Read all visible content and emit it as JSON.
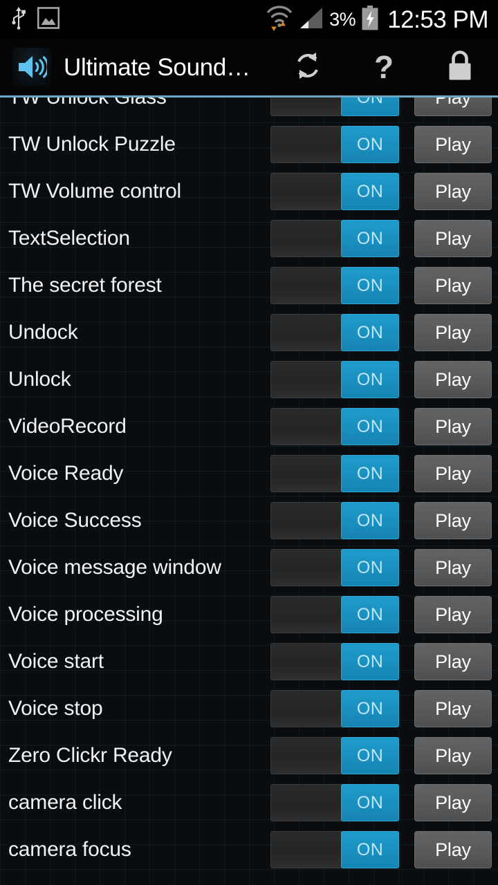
{
  "status_bar": {
    "left_icons": [
      "usb-icon",
      "screenshot-image-icon"
    ],
    "right_icons": [
      "wifi-transfer-icon",
      "cellular-signal-icon",
      "battery-charging-icon"
    ],
    "battery_percent": "3%",
    "clock": "12:53 PM"
  },
  "action_bar": {
    "app_icon": "speaker-volume-icon",
    "title": "Ultimate Sound…",
    "actions": [
      {
        "name": "refresh-button",
        "icon": "refresh-icon"
      },
      {
        "name": "help-button",
        "icon": "question-mark-icon",
        "label": "?"
      },
      {
        "name": "lock-button",
        "icon": "lock-icon"
      }
    ]
  },
  "list": {
    "toggle_on_label": "ON",
    "play_label": "Play",
    "rows": [
      {
        "label": "TW Unlock Glass",
        "toggle": "ON",
        "play": "Play"
      },
      {
        "label": "TW Unlock Puzzle",
        "toggle": "ON",
        "play": "Play"
      },
      {
        "label": "TW Volume control",
        "toggle": "ON",
        "play": "Play"
      },
      {
        "label": "TextSelection",
        "toggle": "ON",
        "play": "Play"
      },
      {
        "label": "The secret forest",
        "toggle": "ON",
        "play": "Play"
      },
      {
        "label": "Undock",
        "toggle": "ON",
        "play": "Play"
      },
      {
        "label": "Unlock",
        "toggle": "ON",
        "play": "Play"
      },
      {
        "label": "VideoRecord",
        "toggle": "ON",
        "play": "Play"
      },
      {
        "label": "Voice Ready",
        "toggle": "ON",
        "play": "Play"
      },
      {
        "label": "Voice Success",
        "toggle": "ON",
        "play": "Play"
      },
      {
        "label": "Voice message window",
        "toggle": "ON",
        "play": "Play"
      },
      {
        "label": "Voice processing",
        "toggle": "ON",
        "play": "Play"
      },
      {
        "label": "Voice start",
        "toggle": "ON",
        "play": "Play"
      },
      {
        "label": "Voice stop",
        "toggle": "ON",
        "play": "Play"
      },
      {
        "label": "Zero Clickr Ready",
        "toggle": "ON",
        "play": "Play"
      },
      {
        "label": "camera click",
        "toggle": "ON",
        "play": "Play"
      },
      {
        "label": "camera focus",
        "toggle": "ON",
        "play": "Play"
      }
    ]
  },
  "colors": {
    "accent_blue": "#1a90c0",
    "divider_blue": "#6ca6c4",
    "background": "#0a0d10",
    "play_button": "#5a5a5a"
  }
}
